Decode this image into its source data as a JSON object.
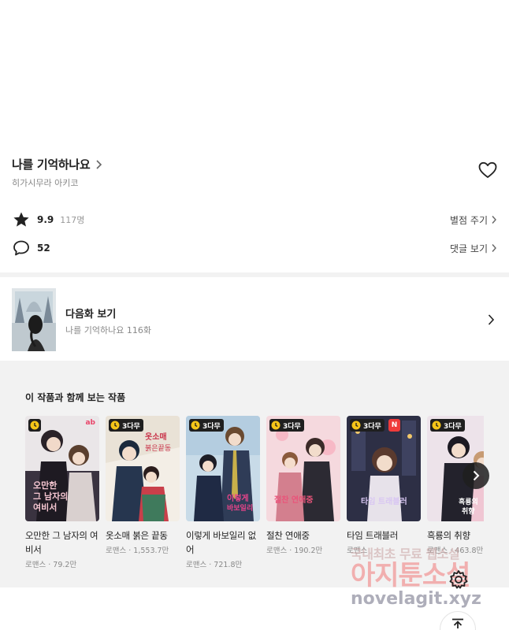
{
  "work": {
    "title": "나를 기억하나요",
    "author": "히가시무라 아키코",
    "rating": "9.9",
    "rating_count": "117명",
    "rate_link": "별점 주기",
    "comment_count": "52",
    "comment_link": "댓글 보기"
  },
  "next_episode": {
    "label": "다음화 보기",
    "subtitle": "나를 기억하나요 116화"
  },
  "recommendations": {
    "section_title": "이 작품과 함께 보는 작품",
    "items": [
      {
        "title": "오만한 그 남자의 여비서",
        "genre": "로맨스",
        "views": "79.2만",
        "badge": "",
        "extra_badge": "ab"
      },
      {
        "title": "옷소매 붉은 끝동",
        "genre": "로맨스",
        "views": "1,553.7만",
        "badge": "3다무",
        "extra_badge": ""
      },
      {
        "title": "이렇게 바보일리 없어",
        "genre": "로맨스",
        "views": "721.8만",
        "badge": "3다무",
        "extra_badge": ""
      },
      {
        "title": "절찬 연애중",
        "genre": "로맨스",
        "views": "190.2만",
        "badge": "3다무",
        "extra_badge": ""
      },
      {
        "title": "타임 트래블러",
        "genre": "로맨스",
        "views": "",
        "badge": "3다무",
        "extra_badge": "N"
      },
      {
        "title": "흑룡의 취향",
        "genre": "로맨스",
        "views": "463.8만",
        "badge": "3다무",
        "extra_badge": ""
      }
    ]
  },
  "watermark": {
    "line1": "국내최초 무료 웹소설",
    "line2": "아지툰소설",
    "line3": "novelagit.xyz"
  },
  "colors": {
    "page_bg": "#f2f2f2",
    "card_bg": "#ffffff",
    "badge_bg": "#1f1f1f",
    "clock_yellow": "#f5c518",
    "new_badge": "#ef3b3b"
  },
  "icons": {
    "title_link": "chevron-right-icon",
    "like": "heart-outline-icon",
    "rating": "star-icon",
    "comment": "speech-bubble-icon",
    "free_wait": "clock-icon",
    "carousel_next": "chevron-right-icon",
    "settings": "gear-icon",
    "scroll_top": "arrow-up-to-line-icon"
  }
}
